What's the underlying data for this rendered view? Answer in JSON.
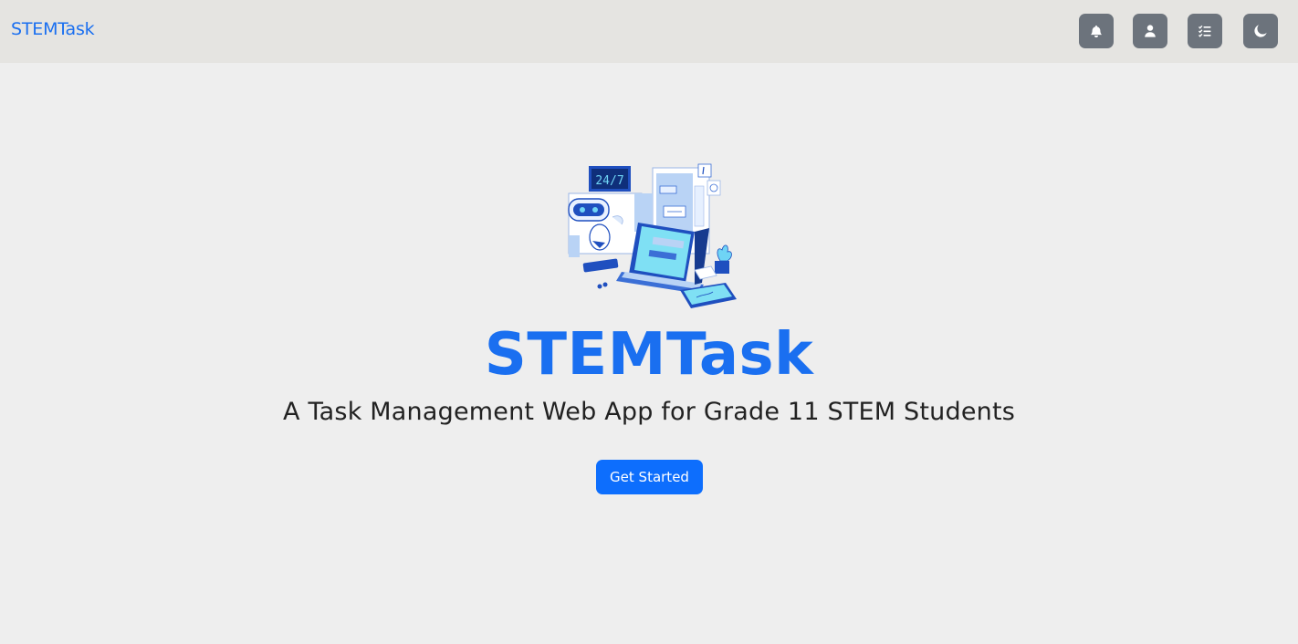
{
  "navbar": {
    "brand": "STEMTask",
    "buttons": [
      {
        "name": "notifications",
        "icon": "bell-icon"
      },
      {
        "name": "profile",
        "icon": "user-icon"
      },
      {
        "name": "tasks",
        "icon": "checklist-icon"
      },
      {
        "name": "theme-toggle",
        "icon": "moon-icon"
      }
    ]
  },
  "hero": {
    "illustration": {
      "clock_text": "24/7"
    },
    "title": "STEMTask",
    "subtitle": "A Task Management Web App for Grade 11 STEM Students",
    "cta_label": "Get Started"
  },
  "colors": {
    "accent": "#1a6ff0",
    "button_primary": "#0d6efd",
    "nav_bg": "#e5e4e1",
    "page_bg": "#eeeeee",
    "icon_button_bg": "#6c737c"
  }
}
